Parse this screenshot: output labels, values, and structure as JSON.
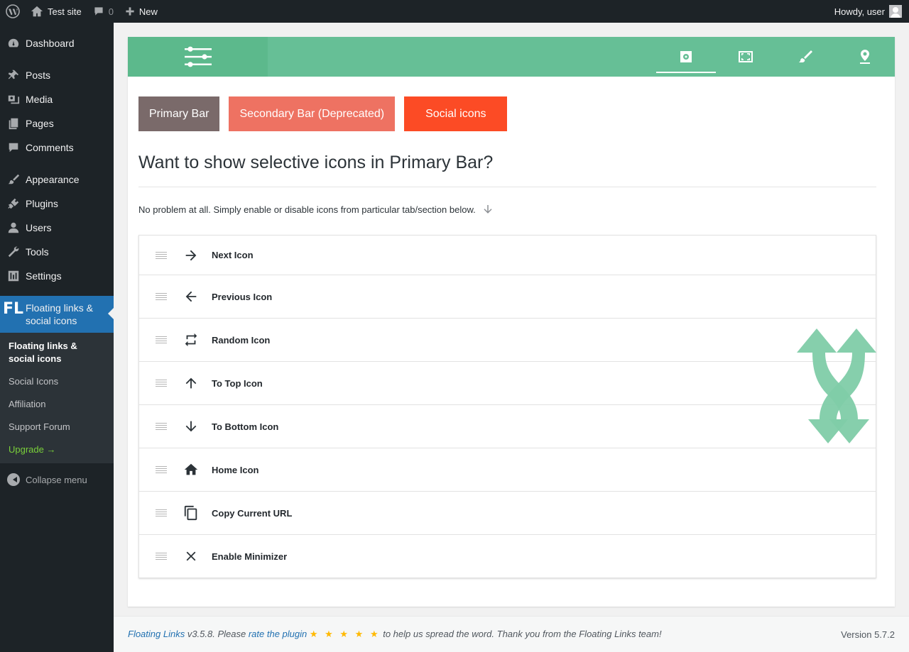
{
  "adminbar": {
    "site_name": "Test site",
    "comments_count": "0",
    "new_label": "New",
    "greeting": "Howdy, user"
  },
  "sidebar": {
    "items": [
      {
        "label": "Dashboard",
        "icon": "dashboard-icon"
      },
      {
        "label": "Posts",
        "icon": "pin-icon"
      },
      {
        "label": "Media",
        "icon": "media-icon"
      },
      {
        "label": "Pages",
        "icon": "pages-icon"
      },
      {
        "label": "Comments",
        "icon": "comment-icon"
      },
      {
        "label": "Appearance",
        "icon": "brush-icon"
      },
      {
        "label": "Plugins",
        "icon": "plug-icon"
      },
      {
        "label": "Users",
        "icon": "user-icon"
      },
      {
        "label": "Tools",
        "icon": "wrench-icon"
      },
      {
        "label": "Settings",
        "icon": "settings-icon"
      }
    ],
    "current": {
      "badge": "FL",
      "label": "Floating links & social icons"
    },
    "submenu": [
      "Floating links & social icons",
      "Social Icons",
      "Affiliation",
      "Support Forum",
      "Upgrade →"
    ],
    "collapse_label": "Collapse menu"
  },
  "panel": {
    "tabs": [
      "settings-cog-icon",
      "fullscreen-icon",
      "brush-icon",
      "location-pin-icon"
    ],
    "buttons": {
      "primary": "Primary Bar",
      "secondary": "Secondary Bar (Deprecated)",
      "social": "Social icons"
    },
    "heading": "Want to show selective icons in Primary Bar?",
    "note": "No problem at all. Simply enable or disable icons from particular tab/section below.",
    "rows": [
      {
        "label": "Next Icon",
        "icon": "arrow-right-icon"
      },
      {
        "label": "Previous Icon",
        "icon": "arrow-left-icon"
      },
      {
        "label": "Random Icon",
        "icon": "repeat-icon"
      },
      {
        "label": "To Top Icon",
        "icon": "arrow-up-icon"
      },
      {
        "label": "To Bottom Icon",
        "icon": "arrow-down-icon"
      },
      {
        "label": "Home Icon",
        "icon": "home-icon"
      },
      {
        "label": "Copy Current URL",
        "icon": "copy-icon"
      },
      {
        "label": "Enable Minimizer",
        "icon": "close-icon"
      }
    ]
  },
  "footer": {
    "plugin_link": "Floating Links",
    "version_text": " v3.5.8. Please ",
    "rate_link": "rate the plugin",
    "stars": "★ ★ ★ ★ ★",
    "thanks": " to help us spread the word. Thank you from the Floating Links team!",
    "wp_version": "Version 5.7.2"
  },
  "colors": {
    "header_green": "#66bf96",
    "primary_button": "#7a6a6a",
    "secondary_button": "#ee7262",
    "social_button": "#fc4b25",
    "admin_blue": "#2271b1"
  }
}
